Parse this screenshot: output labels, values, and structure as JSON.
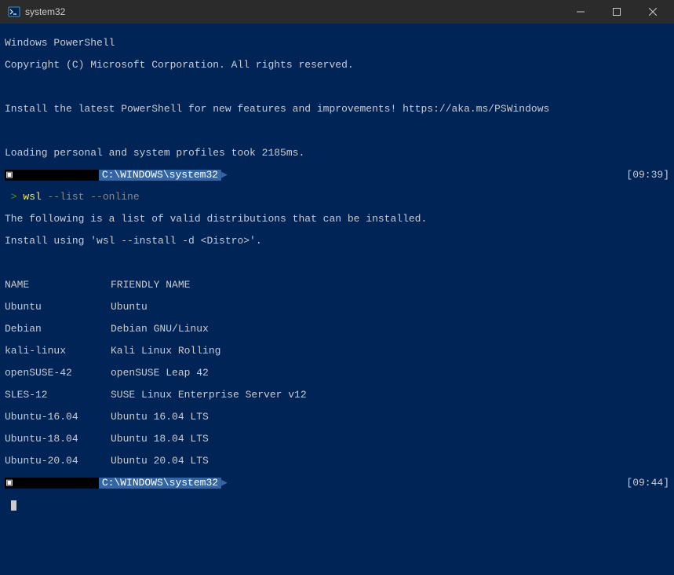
{
  "window": {
    "title": "system32"
  },
  "header": {
    "line1": "Windows PowerShell",
    "line2": "Copyright (C) Microsoft Corporation. All rights reserved.",
    "install_msg": "Install the latest PowerShell for new features and improvements! https://aka.ms/PSWindows",
    "profiles_msg": "Loading personal and system profiles took 2185ms."
  },
  "prompt1": {
    "path": "C:\\WINDOWS\\system32",
    "time": "[09:39]"
  },
  "command": {
    "caret": " > ",
    "name": "wsl",
    "args": " --list --online"
  },
  "output": {
    "line1": "The following is a list of valid distributions that can be installed.",
    "line2": "Install using 'wsl --install -d <Distro>'.",
    "header_name": "NAME",
    "header_friendly": "FRIENDLY NAME",
    "distros": [
      {
        "name": "Ubuntu",
        "friendly": "Ubuntu"
      },
      {
        "name": "Debian",
        "friendly": "Debian GNU/Linux"
      },
      {
        "name": "kali-linux",
        "friendly": "Kali Linux Rolling"
      },
      {
        "name": "openSUSE-42",
        "friendly": "openSUSE Leap 42"
      },
      {
        "name": "SLES-12",
        "friendly": "SUSE Linux Enterprise Server v12"
      },
      {
        "name": "Ubuntu-16.04",
        "friendly": "Ubuntu 16.04 LTS"
      },
      {
        "name": "Ubuntu-18.04",
        "friendly": "Ubuntu 18.04 LTS"
      },
      {
        "name": "Ubuntu-20.04",
        "friendly": "Ubuntu 20.04 LTS"
      }
    ]
  },
  "prompt2": {
    "path": "C:\\WINDOWS\\system32",
    "time": "[09:44]"
  }
}
